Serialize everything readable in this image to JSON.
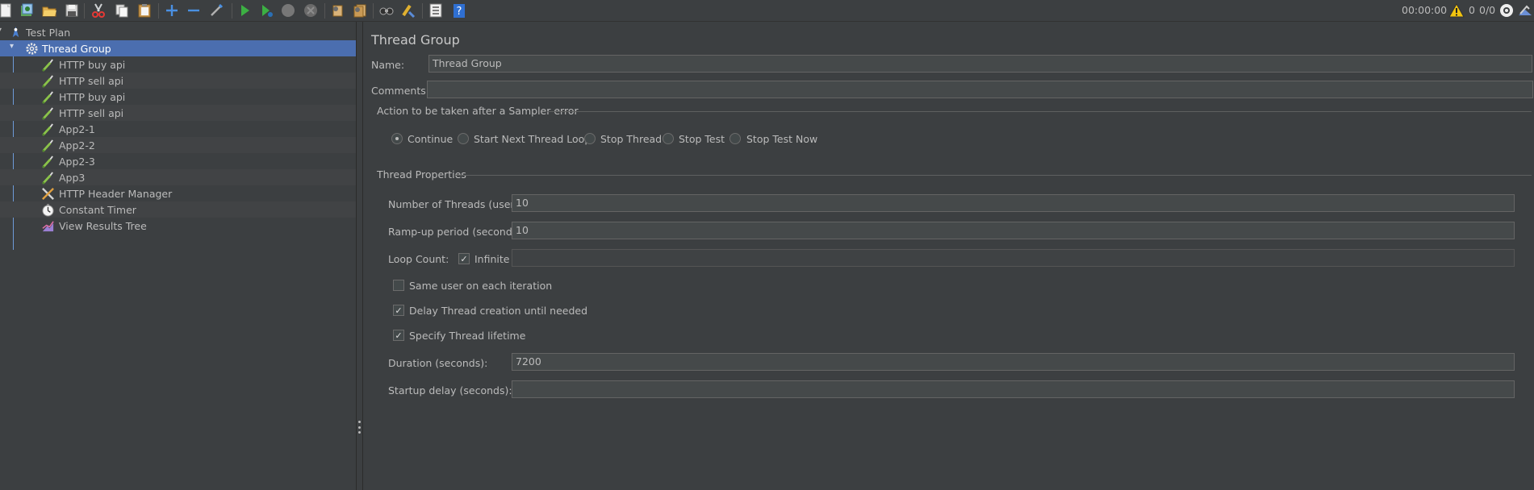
{
  "toolbar": {
    "elapsed_time": "00:00:00",
    "warning_count": "0",
    "thread_count": "0/0",
    "buttons": [
      "new-icon",
      "templates-icon",
      "open-icon",
      "save-icon",
      "cut-icon",
      "copy-icon",
      "paste-icon",
      "expand-icon",
      "collapse-icon",
      "toggle-icon",
      "start-icon",
      "start-no-pauses-icon",
      "stop-icon",
      "shutdown-icon",
      "clear-icon",
      "clear-all-icon",
      "search-icon",
      "reset-search-icon",
      "function-helper-icon",
      "help-icon"
    ]
  },
  "tree": {
    "items": [
      {
        "label": "Test Plan",
        "icon": "test-plan-icon"
      },
      {
        "label": "Thread Group",
        "icon": "gear-icon"
      },
      {
        "label": "HTTP buy api",
        "icon": "pipette-icon"
      },
      {
        "label": "HTTP sell api",
        "icon": "pipette-icon"
      },
      {
        "label": "HTTP buy api",
        "icon": "pipette-icon"
      },
      {
        "label": "HTTP sell api",
        "icon": "pipette-icon"
      },
      {
        "label": "App2-1",
        "icon": "pipette-icon"
      },
      {
        "label": "App2-2",
        "icon": "pipette-icon"
      },
      {
        "label": "App2-3",
        "icon": "pipette-icon"
      },
      {
        "label": "App3",
        "icon": "pipette-icon"
      },
      {
        "label": "HTTP Header Manager",
        "icon": "wrench-icon"
      },
      {
        "label": "Constant Timer",
        "icon": "timer-icon"
      },
      {
        "label": "View Results Tree",
        "icon": "chart-icon"
      }
    ]
  },
  "panel": {
    "title": "Thread Group",
    "name_label": "Name:",
    "name_value": "Thread Group",
    "comments_label": "Comments:",
    "comments_value": "",
    "error_action": {
      "legend": "Action to be taken after a Sampler error",
      "options": [
        "Continue",
        "Start Next Thread Loop",
        "Stop Thread",
        "Stop Test",
        "Stop Test Now"
      ],
      "selected": "Continue"
    },
    "thread_properties": {
      "legend": "Thread Properties",
      "threads_label": "Number of Threads (users):",
      "threads_value": "10",
      "rampup_label": "Ramp-up period (seconds):",
      "rampup_value": "10",
      "loop_label": "Loop Count:",
      "infinite_label": "Infinite",
      "infinite_checked": true,
      "loop_value": "",
      "same_user_label": "Same user on each iteration",
      "same_user_checked": false,
      "delay_label": "Delay Thread creation until needed",
      "delay_checked": true,
      "lifetime_label": "Specify Thread lifetime",
      "lifetime_checked": true,
      "duration_label": "Duration (seconds):",
      "duration_value": "7200",
      "startup_label": "Startup delay (seconds):",
      "startup_value": ""
    }
  }
}
